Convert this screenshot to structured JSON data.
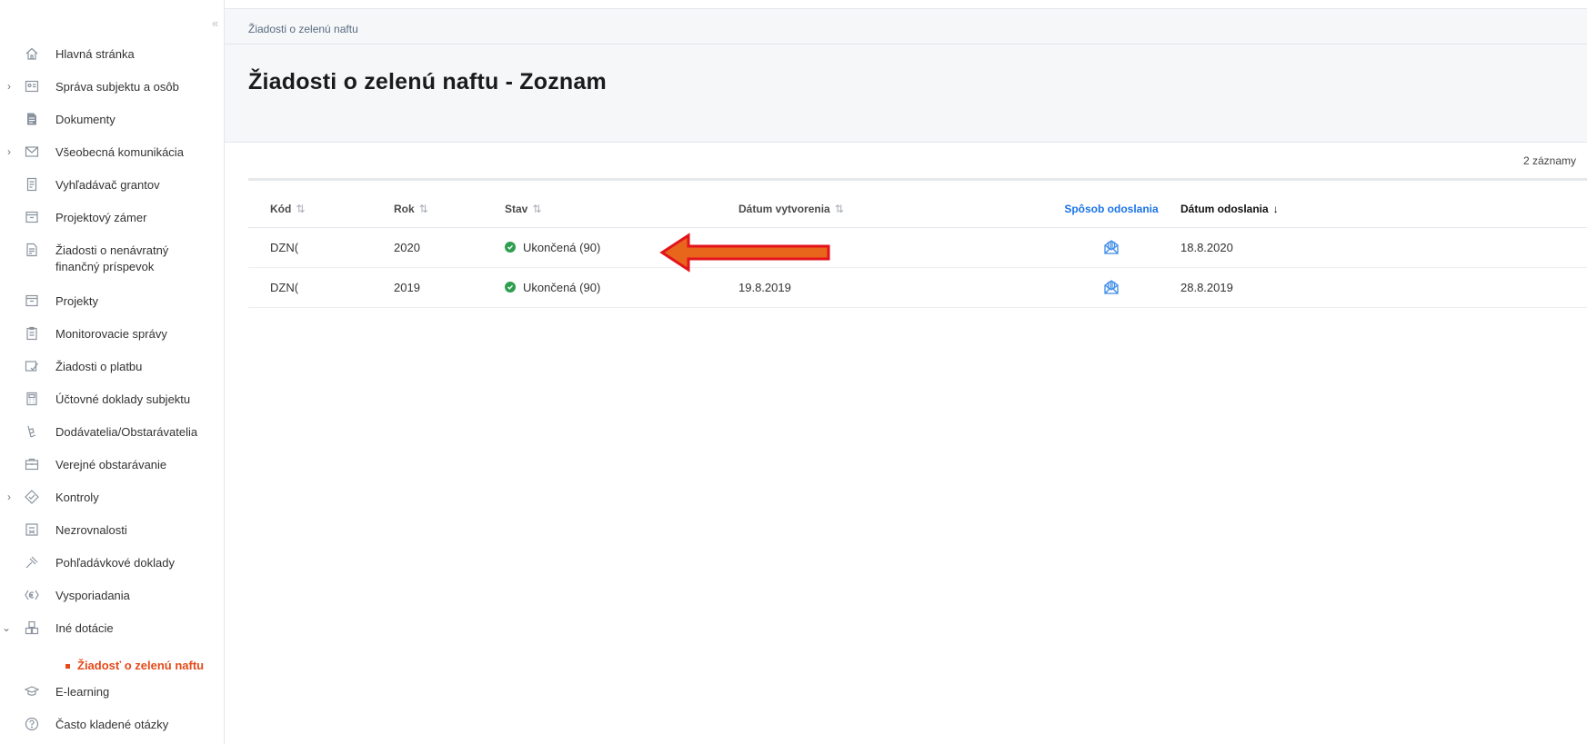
{
  "sidebar": {
    "collapse_label": "«",
    "items": [
      {
        "label": "Hlavná stránka",
        "icon": "home-icon",
        "chevron": ""
      },
      {
        "label": "Správa subjektu a osôb",
        "icon": "id-card-icon",
        "chevron": "›"
      },
      {
        "label": "Dokumenty",
        "icon": "document-icon",
        "chevron": ""
      },
      {
        "label": "Všeobecná komunikácia",
        "icon": "envelope-icon",
        "chevron": "›"
      },
      {
        "label": "Vyhľadávač grantov",
        "icon": "search-list-icon",
        "chevron": ""
      },
      {
        "label": "Projektový zámer",
        "icon": "folder-icon",
        "chevron": ""
      },
      {
        "label": "Žiadosti o nenávratný finančný príspevok",
        "icon": "form-icon",
        "chevron": ""
      },
      {
        "label": "Projekty",
        "icon": "folder-icon",
        "chevron": ""
      },
      {
        "label": "Monitorovacie správy",
        "icon": "clipboard-icon",
        "chevron": ""
      },
      {
        "label": "Žiadosti o platbu",
        "icon": "payment-icon",
        "chevron": ""
      },
      {
        "label": "Účtovné doklady subjektu",
        "icon": "calculator-icon",
        "chevron": ""
      },
      {
        "label": "Dodávatelia/Obstarávatelia",
        "icon": "supplier-icon",
        "chevron": ""
      },
      {
        "label": "Verejné obstarávanie",
        "icon": "briefcase-icon",
        "chevron": ""
      },
      {
        "label": "Kontroly",
        "icon": "check-diamond-icon",
        "chevron": "›"
      },
      {
        "label": "Nezrovnalosti",
        "icon": "irregularity-icon",
        "chevron": ""
      },
      {
        "label": "Pohľadávkové doklady",
        "icon": "gavel-icon",
        "chevron": ""
      },
      {
        "label": "Vysporiadania",
        "icon": "euro-icon",
        "chevron": ""
      },
      {
        "label": "Iné dotácie",
        "icon": "grid-icon",
        "chevron": "⌄"
      }
    ],
    "sub_item": "Žiadosť o zelenú naftu",
    "bottom_items": [
      {
        "label": "E-learning",
        "icon": "graduation-icon",
        "chevron": ""
      },
      {
        "label": "Často kladené otázky",
        "icon": "question-icon",
        "chevron": ""
      }
    ]
  },
  "header": {
    "breadcrumb": "Žiadosti o zelenú naftu",
    "title": "Žiadosti o zelenú naftu - Zoznam"
  },
  "table": {
    "count": "2 záznamy",
    "columns": {
      "kod": "Kód",
      "rok": "Rok",
      "stav": "Stav",
      "datum_vytvorenia": "Dátum vytvorenia",
      "sposob": "Spôsob odoslania",
      "datum_odoslania": "Dátum odoslania"
    },
    "sort_both": "⇅",
    "sort_down": "↓",
    "rows": [
      {
        "kod": "DZN(",
        "rok": "2020",
        "stav": "Ukončená (90)",
        "datum_vytvorenia": "",
        "datum_odoslania": "18.8.2020"
      },
      {
        "kod": "DZN(",
        "rok": "2019",
        "stav": "Ukončená (90)",
        "datum_vytvorenia": "19.8.2019",
        "datum_odoslania": "28.8.2019"
      }
    ]
  },
  "colors": {
    "accent_blue": "#1a73e8",
    "active_orange": "#e64a19",
    "status_green": "#2e9e4f",
    "arrow_fill": "#e8661c",
    "arrow_stroke": "#e3121b"
  }
}
